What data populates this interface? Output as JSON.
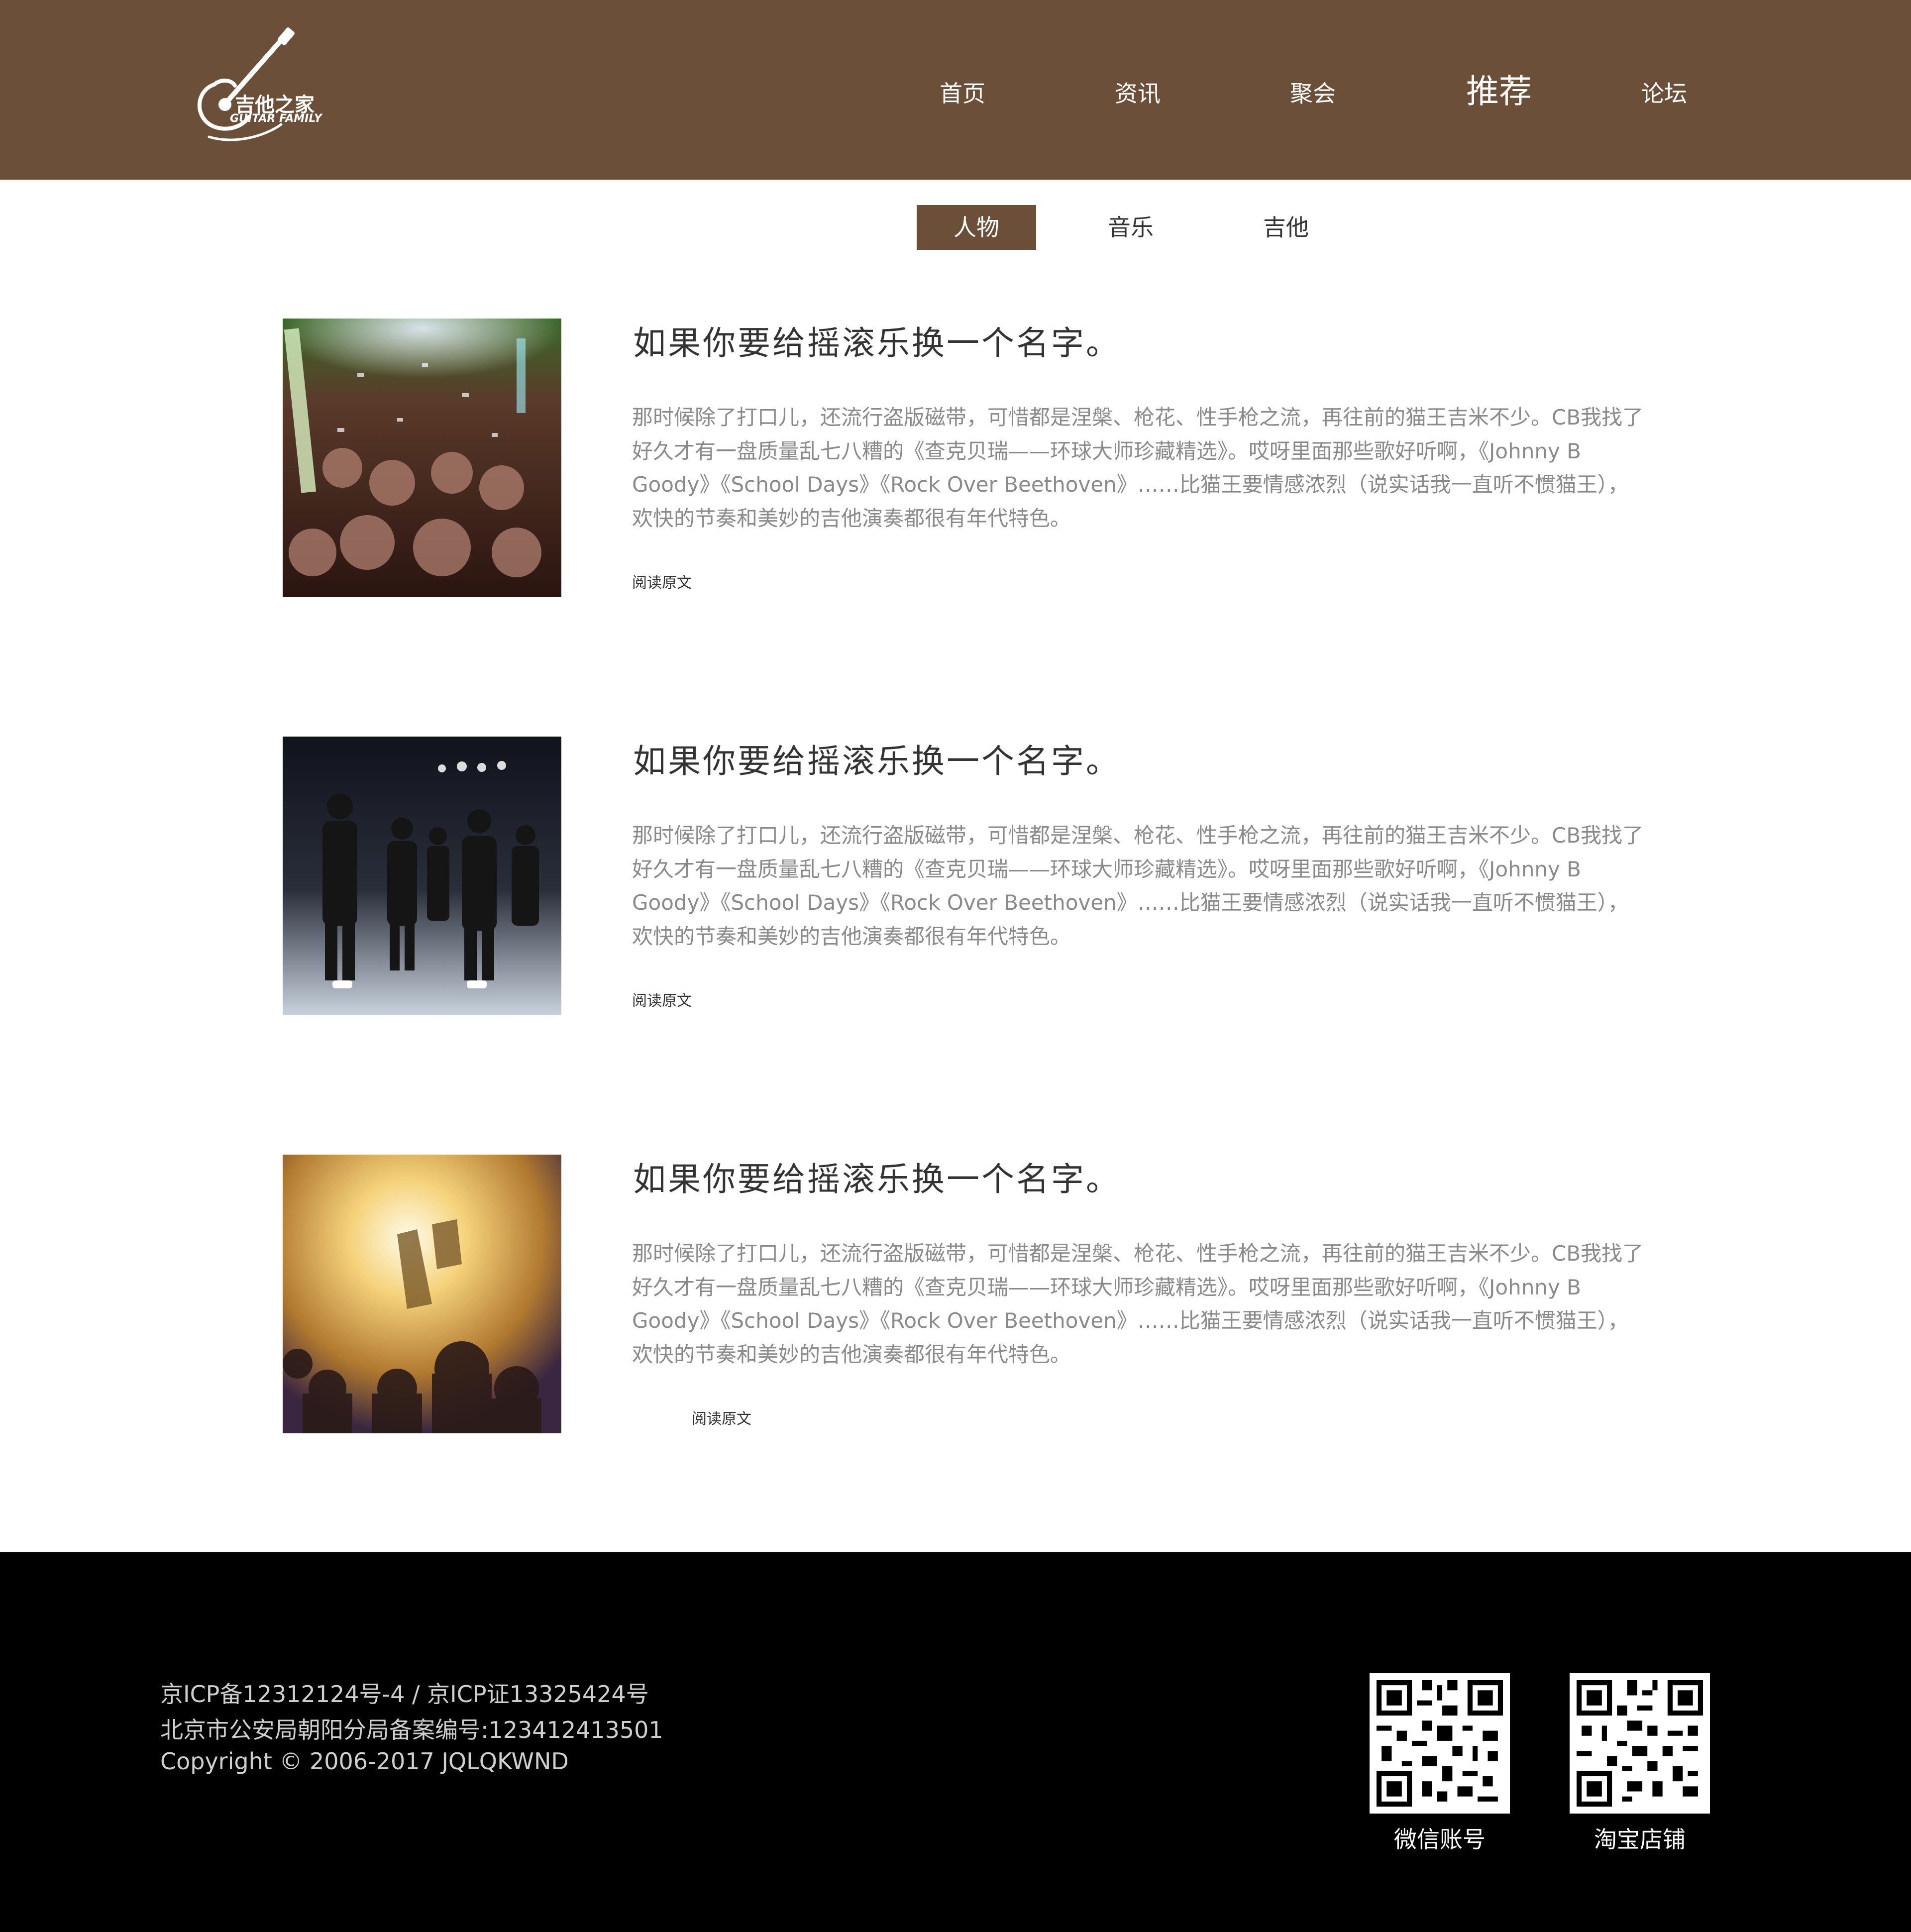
{
  "header": {
    "logo_cn": "吉他之家",
    "logo_en": "GUITAR FAMILY",
    "nav": [
      "首页",
      "资讯",
      "聚会",
      "推荐",
      "论坛"
    ],
    "active_nav_index": 3
  },
  "subtabs": [
    "人物",
    "音乐",
    "吉他"
  ],
  "active_subtab_index": 0,
  "articles": [
    {
      "title": "如果你要给摇滚乐换一个名字。",
      "body": "那时候除了打口儿，还流行盗版磁带，可惜都是涅槃、枪花、性手枪之流，再往前的猫王吉米不少。CB我找了好久才有一盘质量乱七八糟的《查克贝瑞——环球大师珍藏精选》。哎呀里面那些歌好听啊，《Johnny B Goody》《School Days》《Rock Over Beethoven》……比猫王要情感浓烈（说实话我一直听不惯猫王），欢快的节奏和美妙的吉他演奏都很有年代特色。",
      "read_more": "阅读原文",
      "image": "concert-crowd-lightsticks-photo"
    },
    {
      "title": "如果你要给摇滚乐换一个名字。",
      "body": "那时候除了打口儿，还流行盗版磁带，可惜都是涅槃、枪花、性手枪之流，再往前的猫王吉米不少。CB我找了好久才有一盘质量乱七八糟的《查克贝瑞——环球大师珍藏精选》。哎呀里面那些歌好听啊，《Johnny B Goody》《School Days》《Rock Over Beethoven》……比猫王要情感浓烈（说实话我一直听不惯猫王），欢快的节奏和美妙的吉他演奏都很有年代特色。",
      "read_more": "阅读原文",
      "image": "band-on-stage-photo"
    },
    {
      "title": "如果你要给摇滚乐换一个名字。",
      "body": "那时候除了打口儿，还流行盗版磁带，可惜都是涅槃、枪花、性手枪之流，再往前的猫王吉米不少。CB我找了好久才有一盘质量乱七八糟的《查克贝瑞——环球大师珍藏精选》。哎呀里面那些歌好听啊，《Johnny B Goody》《School Days》《Rock Over Beethoven》……比猫王要情感浓烈（说实话我一直听不惯猫王），欢快的节奏和美妙的吉他演奏都很有年代特色。",
      "read_more": "阅读原文",
      "image": "festival-stage-lights-photo"
    }
  ],
  "footer": {
    "lines": [
      "京ICP备12312124号-4 / 京ICP证13325424号",
      "北京市公安局朝阳分局备案编号:123412413501",
      "Copyright © 2006-2017 JQLQKWND"
    ],
    "qr_codes": [
      {
        "label": "微信账号",
        "icon": "qr-code-icon"
      },
      {
        "label": "淘宝店铺",
        "icon": "qr-code-icon"
      }
    ]
  },
  "colors": {
    "brand": "#6b4f39",
    "footer_bg": "#000000",
    "body_text": "#8a8a8a",
    "title_text": "#333333"
  }
}
